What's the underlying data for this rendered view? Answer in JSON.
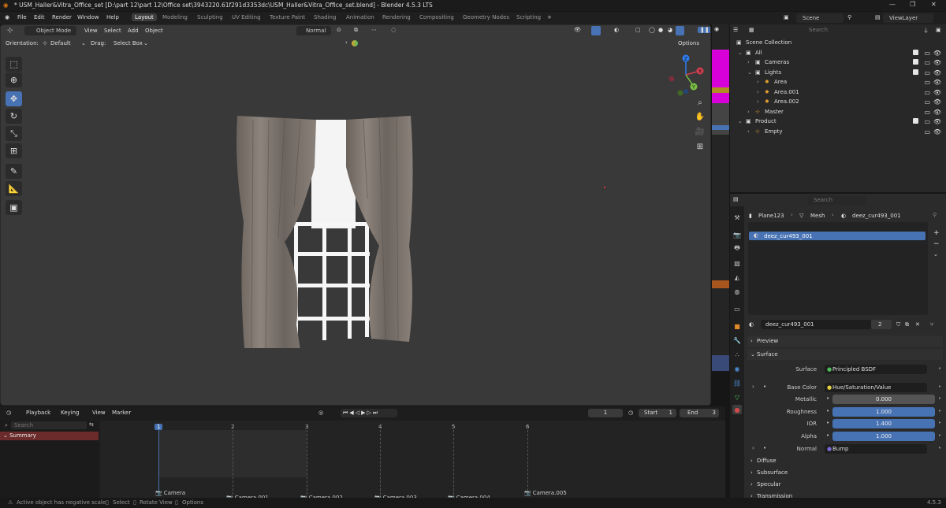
{
  "titlebar": {
    "title": "* USM_Haller&Vitra_Office_set [D:\\part 12\\part 12\\Office set\\3943220.61f291d3353dc\\USM_Haller&Vitra_Office_set.blend] - Blender 4.5.3 LTS"
  },
  "menu": [
    "File",
    "Edit",
    "Render",
    "Window",
    "Help"
  ],
  "workspaces": [
    "Layout",
    "Modeling",
    "Sculpting",
    "UV Editing",
    "Texture Paint",
    "Shading",
    "Animation",
    "Rendering",
    "Compositing",
    "Geometry Nodes",
    "Scripting"
  ],
  "scene": {
    "label": "Scene",
    "view_layer": "ViewLayer"
  },
  "viewport": {
    "mode": "Object Mode",
    "menus": [
      "View",
      "Select",
      "Add",
      "Object"
    ],
    "transform": "Normal",
    "orientation_label": "Orientation:",
    "orientation": "Default",
    "drag_label": "Drag:",
    "drag": "Select Box",
    "options": "Options",
    "gizmo": {
      "x": "X",
      "y": "Y",
      "z": "Z"
    }
  },
  "outliner": {
    "search_placeholder": "Search",
    "rows": [
      {
        "name": "Scene Collection",
        "indent": 0
      },
      {
        "name": "All",
        "indent": 1
      },
      {
        "name": "Cameras",
        "indent": 2
      },
      {
        "name": "Lights",
        "indent": 2
      },
      {
        "name": "Area",
        "indent": 3
      },
      {
        "name": "Area.001",
        "indent": 3
      },
      {
        "name": "Area.002",
        "indent": 3
      },
      {
        "name": "Master",
        "indent": 2
      },
      {
        "name": "Product",
        "indent": 1
      },
      {
        "name": "Empty",
        "indent": 2
      }
    ]
  },
  "properties": {
    "search_placeholder": "Search",
    "breadcrumb": [
      "Plane123",
      "Mesh",
      "deez_cur493_001"
    ],
    "slot": "deez_cur493_001",
    "material": "deez_cur493_001",
    "users": "2",
    "sections": {
      "preview": "Preview",
      "surface": "Surface"
    },
    "fields": [
      {
        "label": "Surface",
        "value": "Principled BSDF",
        "kind": "link"
      },
      {
        "label": "Base Color",
        "value": "Hue/Saturation/Value",
        "kind": "link"
      },
      {
        "label": "Metallic",
        "value": "0.000",
        "kind": "num"
      },
      {
        "label": "Roughness",
        "value": "1.000",
        "kind": "bar"
      },
      {
        "label": "IOR",
        "value": "1.400",
        "kind": "bar"
      },
      {
        "label": "Alpha",
        "value": "1.000",
        "kind": "bar"
      },
      {
        "label": "Normal",
        "value": "Bump",
        "kind": "link"
      }
    ],
    "subsections": [
      "Diffuse",
      "Subsurface",
      "Specular",
      "Transmission"
    ]
  },
  "timeline": {
    "menus": [
      "Playback",
      "Keying",
      "View",
      "Marker"
    ],
    "current": "1",
    "start_label": "Start",
    "start": "1",
    "end_label": "End",
    "end": "3",
    "search_placeholder": "Search",
    "summary": "Summary",
    "ticks": [
      "1",
      "2",
      "3",
      "4",
      "5",
      "6"
    ],
    "markers": [
      "Camera",
      "Camera.001",
      "Camera.002",
      "Camera.003",
      "Camera.004",
      "Camera.005"
    ]
  },
  "status": {
    "left": "Active object has negative scale",
    "select": "Select",
    "rotate": "Rotate View",
    "options": "Options",
    "version": "4.5.3"
  }
}
